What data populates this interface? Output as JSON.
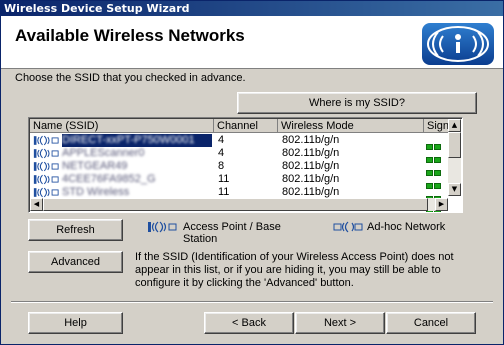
{
  "window": {
    "title": "Wireless Device Setup Wizard"
  },
  "header": {
    "title": "Available Wireless Networks"
  },
  "instruction": "Choose the SSID that you checked in advance.",
  "buttons": {
    "where_ssid": "Where is my SSID?",
    "refresh": "Refresh",
    "advanced": "Advanced",
    "help": "Help",
    "back": "< Back",
    "next": "Next >",
    "cancel": "Cancel"
  },
  "table": {
    "columns": [
      "Name (SSID)",
      "Channel",
      "Wireless Mode",
      "Signal"
    ],
    "rows": [
      {
        "ssid": "DIRECT-xxPT-P750W0001",
        "channel": "4",
        "mode": "802.11b/g/n",
        "signal_bars": 4,
        "selected": true
      },
      {
        "ssid": "APPLEScanner0",
        "channel": "4",
        "mode": "802.11b/g/n",
        "signal_bars": 4,
        "selected": false
      },
      {
        "ssid": "NETGEAR49",
        "channel": "8",
        "mode": "802.11b/g/n",
        "signal_bars": 4,
        "selected": false
      },
      {
        "ssid": "4CEE76FA9852_G",
        "channel": "11",
        "mode": "802.11b/g/n",
        "signal_bars": 4,
        "selected": false
      },
      {
        "ssid": "STD Wireless",
        "channel": "11",
        "mode": "802.11b/g/n",
        "signal_bars": 4,
        "selected": false
      }
    ]
  },
  "legend": {
    "access_point_line1": "Access Point / Base",
    "access_point_line2": "Station",
    "adhoc": "Ad-hoc Network"
  },
  "advanced_note": "If the SSID (Identification of your Wireless Access Point) does not appear in this list, or if you are hiding it, you may still be able to configure it by clicking the 'Advanced' button.",
  "colors": {
    "title_bar": "#0a246a",
    "selection": "#0a246a",
    "signal": "#1aa61a",
    "dialog_bg": "#d4d0c8"
  }
}
